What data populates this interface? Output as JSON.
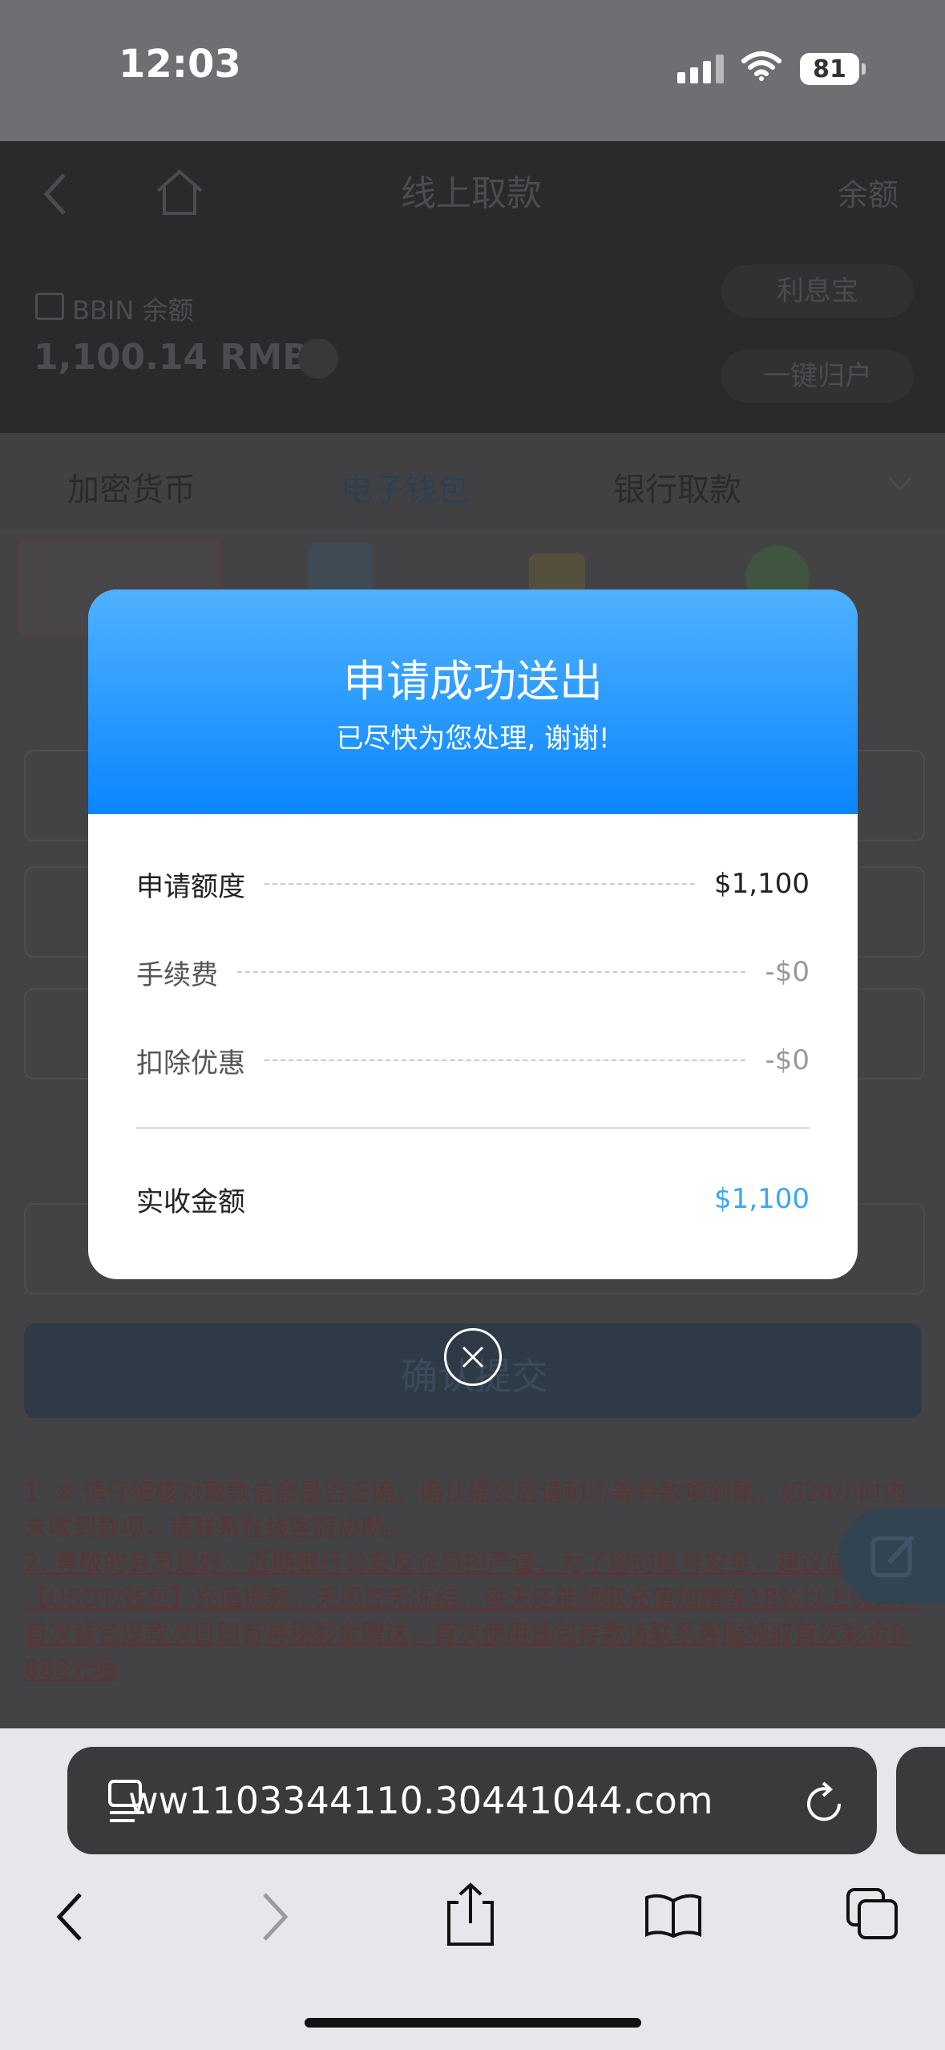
{
  "status_bar": {
    "time": "12:03",
    "battery": "81"
  },
  "page": {
    "title": "线上取款",
    "balance_link": "余额",
    "account_label": "BBIN 余额",
    "balance": "1,100.14 RMB",
    "interest_button": "利息宝",
    "one_click_button": "一键归户",
    "tabs": [
      "加密货币",
      "电子钱包",
      "银行取款"
    ],
    "submit_label": "确认提交",
    "notes": [
      "1. ※ 请仔细核对取款信息是否正确，确认提交后请耐心等待款项到账，如24小时内未收到款项，请联系在线客服协助。",
      "2. 尊敬的会员您好，近期银行公安反诈风控严谨，为了您的账号安全，建议使用【USDT/钱包】充值提款，无风控无冻结，每天还能领取充值加赠等18%以上优惠，首次钱包提款次日即有神秘彩金赠送，首次使用钱包存款请联系客服领取首次彩金8-888元哦"
    ]
  },
  "modal": {
    "title": "申请成功送出",
    "subtitle": "已尽快为您处理, 谢谢!",
    "rows": [
      {
        "label": "申请额度",
        "value": "$1,100"
      },
      {
        "label": "手续费",
        "value": "-$0"
      },
      {
        "label": "扣除优惠",
        "value": "-$0"
      }
    ],
    "total_label": "实收金额",
    "total_value": "$1,100",
    "colors": {
      "accent": "#3aa8f0",
      "header_top": "#4fb1ff",
      "header_bottom": "#0a86ff"
    }
  },
  "browser": {
    "url": "ww1103344110.30441044.com",
    "icons": [
      "reader-icon",
      "reload-icon",
      "back-icon",
      "forward-icon",
      "share-icon",
      "bookmarks-icon",
      "tabs-icon"
    ]
  }
}
